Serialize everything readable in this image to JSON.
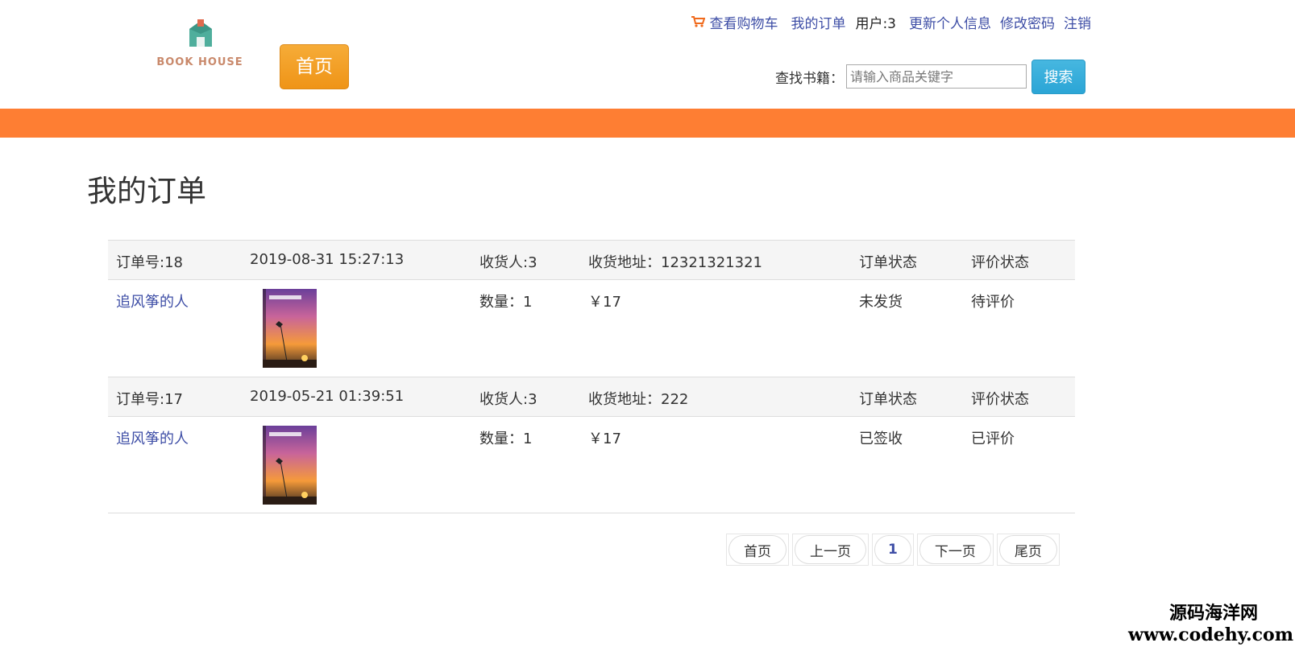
{
  "brand": {
    "logo_text": "BOOK HOUSE",
    "colors": {
      "orange_bar": "#fe7e33",
      "home_btn": "#ef9417",
      "search_btn": "#2ba5d6",
      "link": "#3e4ea6"
    }
  },
  "header": {
    "home_label": "首页",
    "nav": {
      "cart_icon": "shopping-cart-icon",
      "cart": "查看购物车",
      "orders": "我的订单",
      "user": "用户:3",
      "update_info": "更新个人信息",
      "change_password": "修改密码",
      "logout": "注销"
    },
    "search": {
      "label": "查找书籍：",
      "placeholder": "请输入商品关键字",
      "button": "搜索"
    }
  },
  "page_title": "我的订单",
  "orders": [
    {
      "order_no": "订单号:18",
      "time": "2019-08-31 15:27:13",
      "receiver": "收货人:3",
      "address": "收货地址：12321321321",
      "status_header": "订单状态",
      "review_header": "评价状态",
      "item": {
        "title": "追风筝的人",
        "qty": "数量：1",
        "price": "￥17",
        "status": "未发货",
        "review": "待评价"
      }
    },
    {
      "order_no": "订单号:17",
      "time": "2019-05-21 01:39:51",
      "receiver": "收货人:3",
      "address": "收货地址：222",
      "status_header": "订单状态",
      "review_header": "评价状态",
      "item": {
        "title": "追风筝的人",
        "qty": "数量：1",
        "price": "￥17",
        "status": "已签收",
        "review": "已评价"
      }
    }
  ],
  "pagination": {
    "first": "首页",
    "prev": "上一页",
    "current": "1",
    "next": "下一页",
    "last": "尾页"
  },
  "watermark": {
    "line1": "源码海洋网",
    "line2": "www.codehy.com"
  }
}
